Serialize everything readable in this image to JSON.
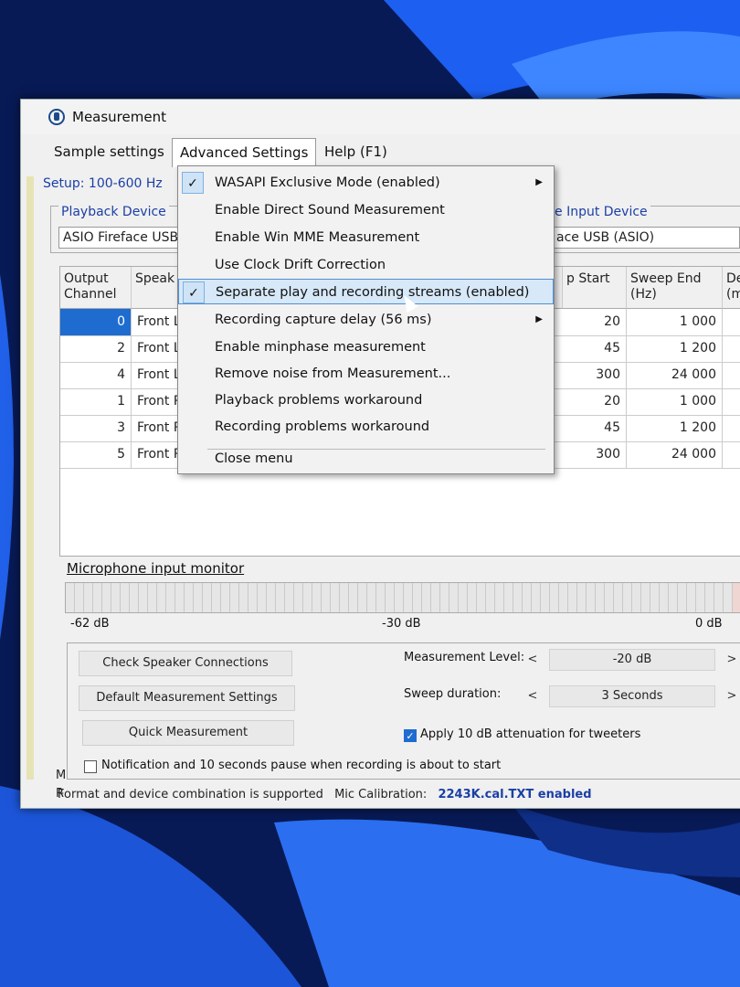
{
  "window": {
    "title": "Measurement"
  },
  "menubar": {
    "items": [
      "Sample settings",
      "Advanced Settings",
      "Help (F1)"
    ]
  },
  "setup_label": "Setup: 100-600 Hz",
  "playback": {
    "label": "Playback Device",
    "value": "ASIO Fireface USB"
  },
  "input": {
    "label": "e Input Device",
    "value": "ace USB (ASIO)"
  },
  "grid": {
    "headers": {
      "output_channel": "Output Channel",
      "speaker": "Speak",
      "start": "p Start",
      "sweep_end": "Sweep End (Hz)",
      "delay": "Dela (msec"
    },
    "rows": [
      {
        "channel": "0",
        "speaker": "Front Le",
        "start": "20",
        "end": "1 000"
      },
      {
        "channel": "2",
        "speaker": "Front Le",
        "start": "45",
        "end": "1 200"
      },
      {
        "channel": "4",
        "speaker": "Front Le",
        "start": "300",
        "end": "24 000"
      },
      {
        "channel": "1",
        "speaker": "Front R",
        "start": "20",
        "end": "1 000"
      },
      {
        "channel": "3",
        "speaker": "Front R",
        "start": "45",
        "end": "1 200"
      },
      {
        "channel": "5",
        "speaker": "Front R",
        "start": "300",
        "end": "24 000"
      }
    ]
  },
  "dropdown": {
    "items": [
      {
        "label": "WASAPI Exclusive Mode (enabled)",
        "checked": "✓",
        "submenu": "▶"
      },
      {
        "label": "Enable Direct Sound Measurement"
      },
      {
        "label": "Enable Win MME Measurement"
      },
      {
        "label": "Use Clock Drift Correction"
      },
      {
        "label": "Separate play and recording streams (enabled)",
        "checked": "✓"
      },
      {
        "label": "Recording capture delay (56 ms)",
        "submenu": "▶"
      },
      {
        "label": "Enable minphase measurement"
      },
      {
        "label": "Remove noise from Measurement..."
      },
      {
        "label": "Playback problems workaround"
      },
      {
        "label": "Recording problems workaround"
      },
      {
        "label": "Close menu"
      }
    ]
  },
  "monitor": {
    "title": "Microphone input monitor",
    "scale": [
      "-62 dB",
      "-30 dB",
      "0 dB"
    ]
  },
  "buttons": {
    "check_speakers": "Check Speaker Connections",
    "default_settings": "Default Measurement Settings",
    "quick": "Quick Measurement"
  },
  "level": {
    "label": "Measurement Level:",
    "value": "-20 dB",
    "left": "<",
    "right": ">"
  },
  "sweep": {
    "label": "Sweep duration:",
    "value": "3 Seconds",
    "left": "<",
    "right": ">"
  },
  "attenuation": {
    "label": "Apply 10 dB attenuation for tweeters",
    "checked": true
  },
  "notification": {
    "label": "Notification and 10 seconds pause when recording is about to start",
    "checked": false
  },
  "status": {
    "text": "Format and device combination is supported",
    "mic_label": "Mic Calibration:",
    "mic_value": "2243K.cal.TXT enabled"
  },
  "side_letters": [
    "M",
    "R"
  ]
}
